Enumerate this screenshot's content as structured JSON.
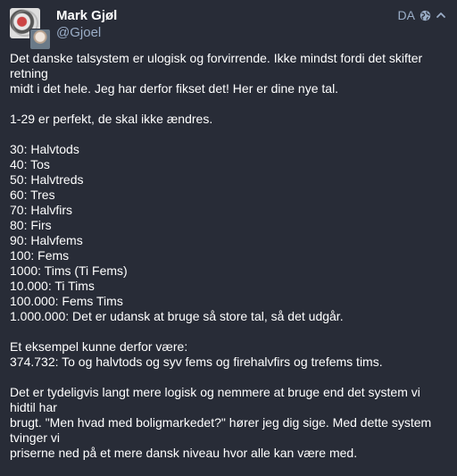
{
  "author": {
    "display_name": "Mark Gjøl",
    "handle": "@Gjoel"
  },
  "meta": {
    "language": "DA",
    "visibility_icon": "globe-icon",
    "collapse_icon": "chevron-up-icon"
  },
  "post": {
    "intro": [
      "Det danske talsystem er ulogisk og forvirrende. Ikke mindst fordi det skifter retning",
      "midt i det hele. Jeg har derfor fikset det! Her er dine nye tal."
    ],
    "keep_note": "1-29 er perfekt, de skal ikke ændres.",
    "numbers": [
      "30: Halvtods",
      "40: Tos",
      "50: Halvtreds",
      "60: Tres",
      "70: Halvfirs",
      "80: Firs",
      "90: Halvfems",
      "100: Fems",
      "1000: Tims (Ti Fems)",
      "10.000: Ti Tims",
      "100.000: Fems Tims",
      "1.000.000: Det er udansk at bruge så store tal, så det udgår."
    ],
    "example": [
      "Et eksempel kunne derfor være:",
      "374.732: To og halvtods og syv fems og firehalvfirs og trefems tims."
    ],
    "conclusion": [
      "Det er tydeligvis langt mere logisk og nemmere at bruge end det system vi hidtil har",
      "brugt. \"Men hvad med boligmarkedet?\" hører jeg dig sige. Med dette system tvinger vi",
      "priserne ned på et mere dansk niveau hvor alle kan være med."
    ]
  },
  "colors": {
    "background": "#282c37",
    "text": "#ffffff",
    "muted": "#9baec8"
  }
}
